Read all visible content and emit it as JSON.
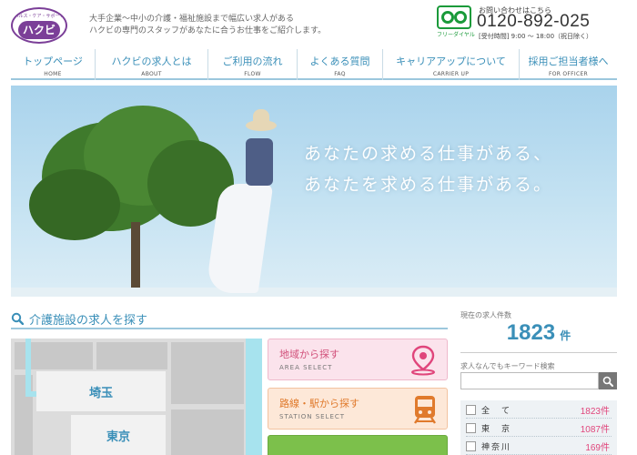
{
  "header": {
    "logo_tagline": "ヘルス・ケア・サポート",
    "logo_word": "ハクビ",
    "tagline_line1": "大手企業～中小の介護・福祉施設まで幅広い求人がある",
    "tagline_line2": "ハクビの専門のスタッフがあなたに合うお仕事をご紹介します。",
    "freedial_label": "フリーダイヤル",
    "contact_title": "お問い合わせはこちら",
    "contact_phone": "0120-892-025",
    "contact_hours": "[受付時間] 9:00 ～ 18:00（祝日除く）"
  },
  "nav": [
    {
      "jp": "トップページ",
      "en": "HOME"
    },
    {
      "jp": "ハクビの求人とは",
      "en": "ABOUT"
    },
    {
      "jp": "ご利用の流れ",
      "en": "FLOW"
    },
    {
      "jp": "よくある質問",
      "en": "FAQ"
    },
    {
      "jp": "キャリアアップについて",
      "en": "CARRIER UP"
    },
    {
      "jp": "採用ご担当者様へ",
      "en": "FOR OFFICER"
    }
  ],
  "hero": {
    "line1": "あなたの求める仕事がある、",
    "line2": "あなたを求める仕事がある。"
  },
  "search": {
    "title": "介護施設の求人を探す",
    "map_regions": [
      "埼玉",
      "東京"
    ],
    "area_select": {
      "jp": "地域から探す",
      "en": "AREA SELECT"
    },
    "station_select": {
      "jp": "路線・駅から探す",
      "en": "STATION SELECT"
    }
  },
  "sidebar": {
    "count_label": "現在の求人件数",
    "count_value": "1823",
    "count_unit": "件",
    "keyword_label": "求人なんでもキーワード検索",
    "keyword_value": "",
    "regions": [
      {
        "name": "全　て",
        "count": "1823件"
      },
      {
        "name": "東　京",
        "count": "1087件"
      },
      {
        "name": "神奈川",
        "count": "169件"
      }
    ]
  },
  "colors": {
    "brand_purple": "#7b3f98",
    "accent_blue": "#3a8fb8",
    "freedial_green": "#1a9a3a",
    "count_pink": "#e0457b"
  }
}
